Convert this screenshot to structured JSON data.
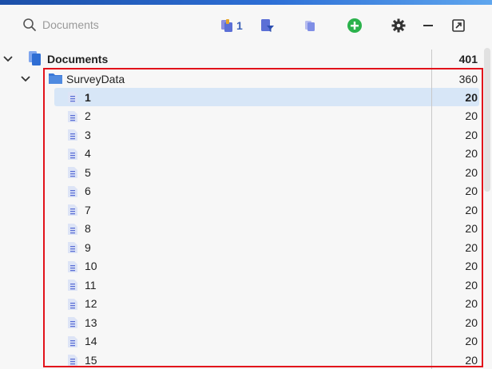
{
  "search": {
    "placeholder": "Documents"
  },
  "toolbar": {
    "selection_count": "1",
    "icons": [
      "docs-select-icon",
      "filter-docs-icon",
      "copy-docs-icon",
      "add-icon",
      "gear-icon",
      "minimize-icon",
      "popout-icon"
    ],
    "colors": {
      "accent": "#5b6fd6",
      "add": "#2bb24c",
      "header_bar": "#2d6fd6"
    }
  },
  "tree": {
    "root": {
      "label": "Documents",
      "count": "401"
    },
    "folder": {
      "label": "SurveyData",
      "count": "360"
    },
    "documents": [
      {
        "label": "1",
        "count": "20",
        "selected": true
      },
      {
        "label": "2",
        "count": "20"
      },
      {
        "label": "3",
        "count": "20"
      },
      {
        "label": "4",
        "count": "20"
      },
      {
        "label": "5",
        "count": "20"
      },
      {
        "label": "6",
        "count": "20"
      },
      {
        "label": "7",
        "count": "20"
      },
      {
        "label": "8",
        "count": "20"
      },
      {
        "label": "9",
        "count": "20"
      },
      {
        "label": "10",
        "count": "20"
      },
      {
        "label": "11",
        "count": "20"
      },
      {
        "label": "12",
        "count": "20"
      },
      {
        "label": "13",
        "count": "20"
      },
      {
        "label": "14",
        "count": "20"
      },
      {
        "label": "15",
        "count": "20"
      }
    ]
  }
}
